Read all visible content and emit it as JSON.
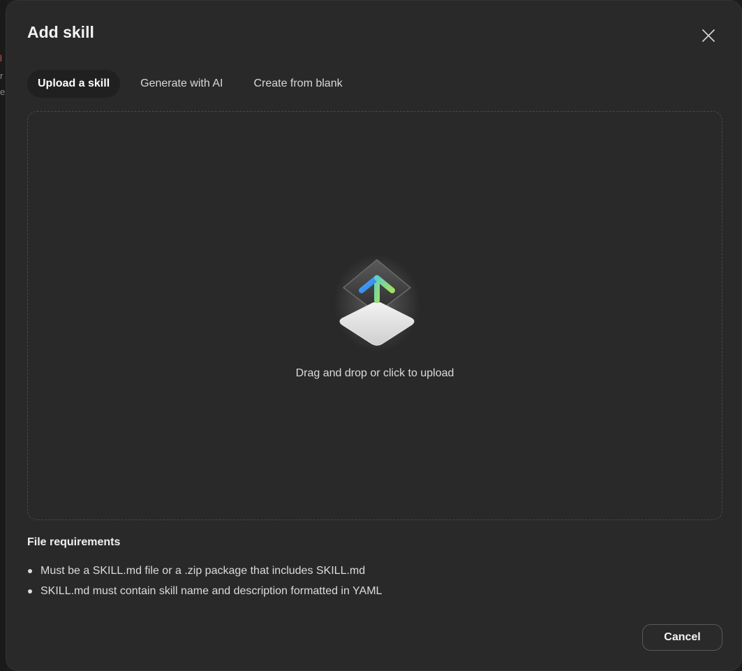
{
  "dialog": {
    "title": "Add skill",
    "close_icon": "close-icon"
  },
  "tabs": [
    {
      "label": "Upload a skill",
      "active": true
    },
    {
      "label": "Generate with AI",
      "active": false
    },
    {
      "label": "Create from blank",
      "active": false
    }
  ],
  "dropzone": {
    "icon": "upload-icon",
    "text": "Drag and drop or click to upload"
  },
  "requirements": {
    "title": "File requirements",
    "items": [
      "Must be a SKILL.md file or a .zip package that includes SKILL.md",
      "SKILL.md must contain skill name and description formatted in YAML"
    ]
  },
  "footer": {
    "cancel_label": "Cancel"
  },
  "colors": {
    "modal_bg": "#292929",
    "accent_blue": "#3a9bff",
    "accent_green": "#9bd86a"
  }
}
